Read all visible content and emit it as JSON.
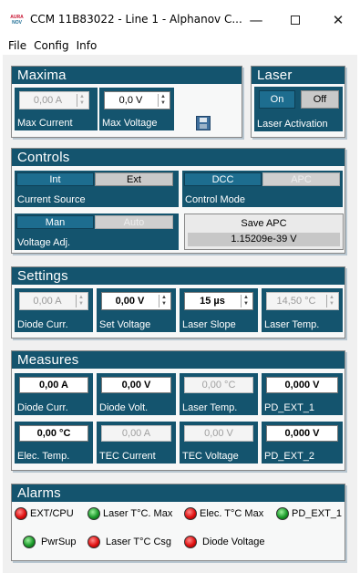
{
  "window": {
    "title": "CCM 11B83022 - Line 1 - Alphanov C...",
    "icon_text_top": "AURA",
    "icon_text_bottom": "NOV",
    "minimize": "—",
    "close": "✕"
  },
  "menu": [
    "File",
    "Config",
    "Info"
  ],
  "maxima": {
    "title": "Maxima",
    "max_current": {
      "value": "0,00 A",
      "label": "Max Current"
    },
    "max_voltage": {
      "value": "0,0 V",
      "label": "Max Voltage"
    },
    "save_icon": "floppy-disk-icon"
  },
  "laser": {
    "title": "Laser",
    "on_label": "On",
    "off_label": "Off",
    "activation_label": "Laser Activation"
  },
  "controls": {
    "title": "Controls",
    "int_label": "Int",
    "ext_label": "Ext",
    "current_source_label": "Current Source",
    "dcc_label": "DCC",
    "apc_label": "APC",
    "control_mode_label": "Control Mode",
    "man_label": "Man",
    "auto_label": "Auto",
    "voltage_adj_label": "Voltage Adj.",
    "save_apc_label": "Save APC",
    "save_apc_value": "1.15209e-39 V"
  },
  "settings": {
    "title": "Settings",
    "items": [
      {
        "value": "0,00 A",
        "label": "Diode Curr."
      },
      {
        "value": "0,00 V",
        "label": "Set Voltage"
      },
      {
        "value": "15 µs",
        "label": "Laser Slope"
      },
      {
        "value": "14,50 °C",
        "label": "Laser Temp."
      }
    ]
  },
  "measures": {
    "title": "Measures",
    "row1": [
      {
        "value": "0,00 A",
        "label": "Diode Curr."
      },
      {
        "value": "0,00 V",
        "label": "Diode Volt."
      },
      {
        "value": "0,00 °C",
        "label": "Laser Temp."
      },
      {
        "value": "0,000 V",
        "label": "PD_EXT_1"
      }
    ],
    "row2": [
      {
        "value": "0,00 °C",
        "label": "Elec. Temp."
      },
      {
        "value": "0,00 A",
        "label": "TEC Current"
      },
      {
        "value": "0,00 V",
        "label": "TEC Voltage"
      },
      {
        "value": "0,000 V",
        "label": "PD_EXT_2"
      }
    ]
  },
  "alarms": {
    "title": "Alarms",
    "items": [
      {
        "label": "EXT/CPU",
        "state": "red"
      },
      {
        "label": "Laser T°C. Max",
        "state": "green"
      },
      {
        "label": "Elec. T°C Max",
        "state": "red"
      },
      {
        "label": "PD_EXT_1",
        "state": "green"
      },
      {
        "label": "PwrSup",
        "state": "green"
      },
      {
        "label": "Laser T°C Csg",
        "state": "red"
      },
      {
        "label": "Diode Voltage",
        "state": "red"
      }
    ]
  },
  "colors": {
    "panel_header": "#14546e",
    "button_on": "#1d6d8f",
    "led_red": "#e01010",
    "led_green": "#1a9a2a"
  }
}
